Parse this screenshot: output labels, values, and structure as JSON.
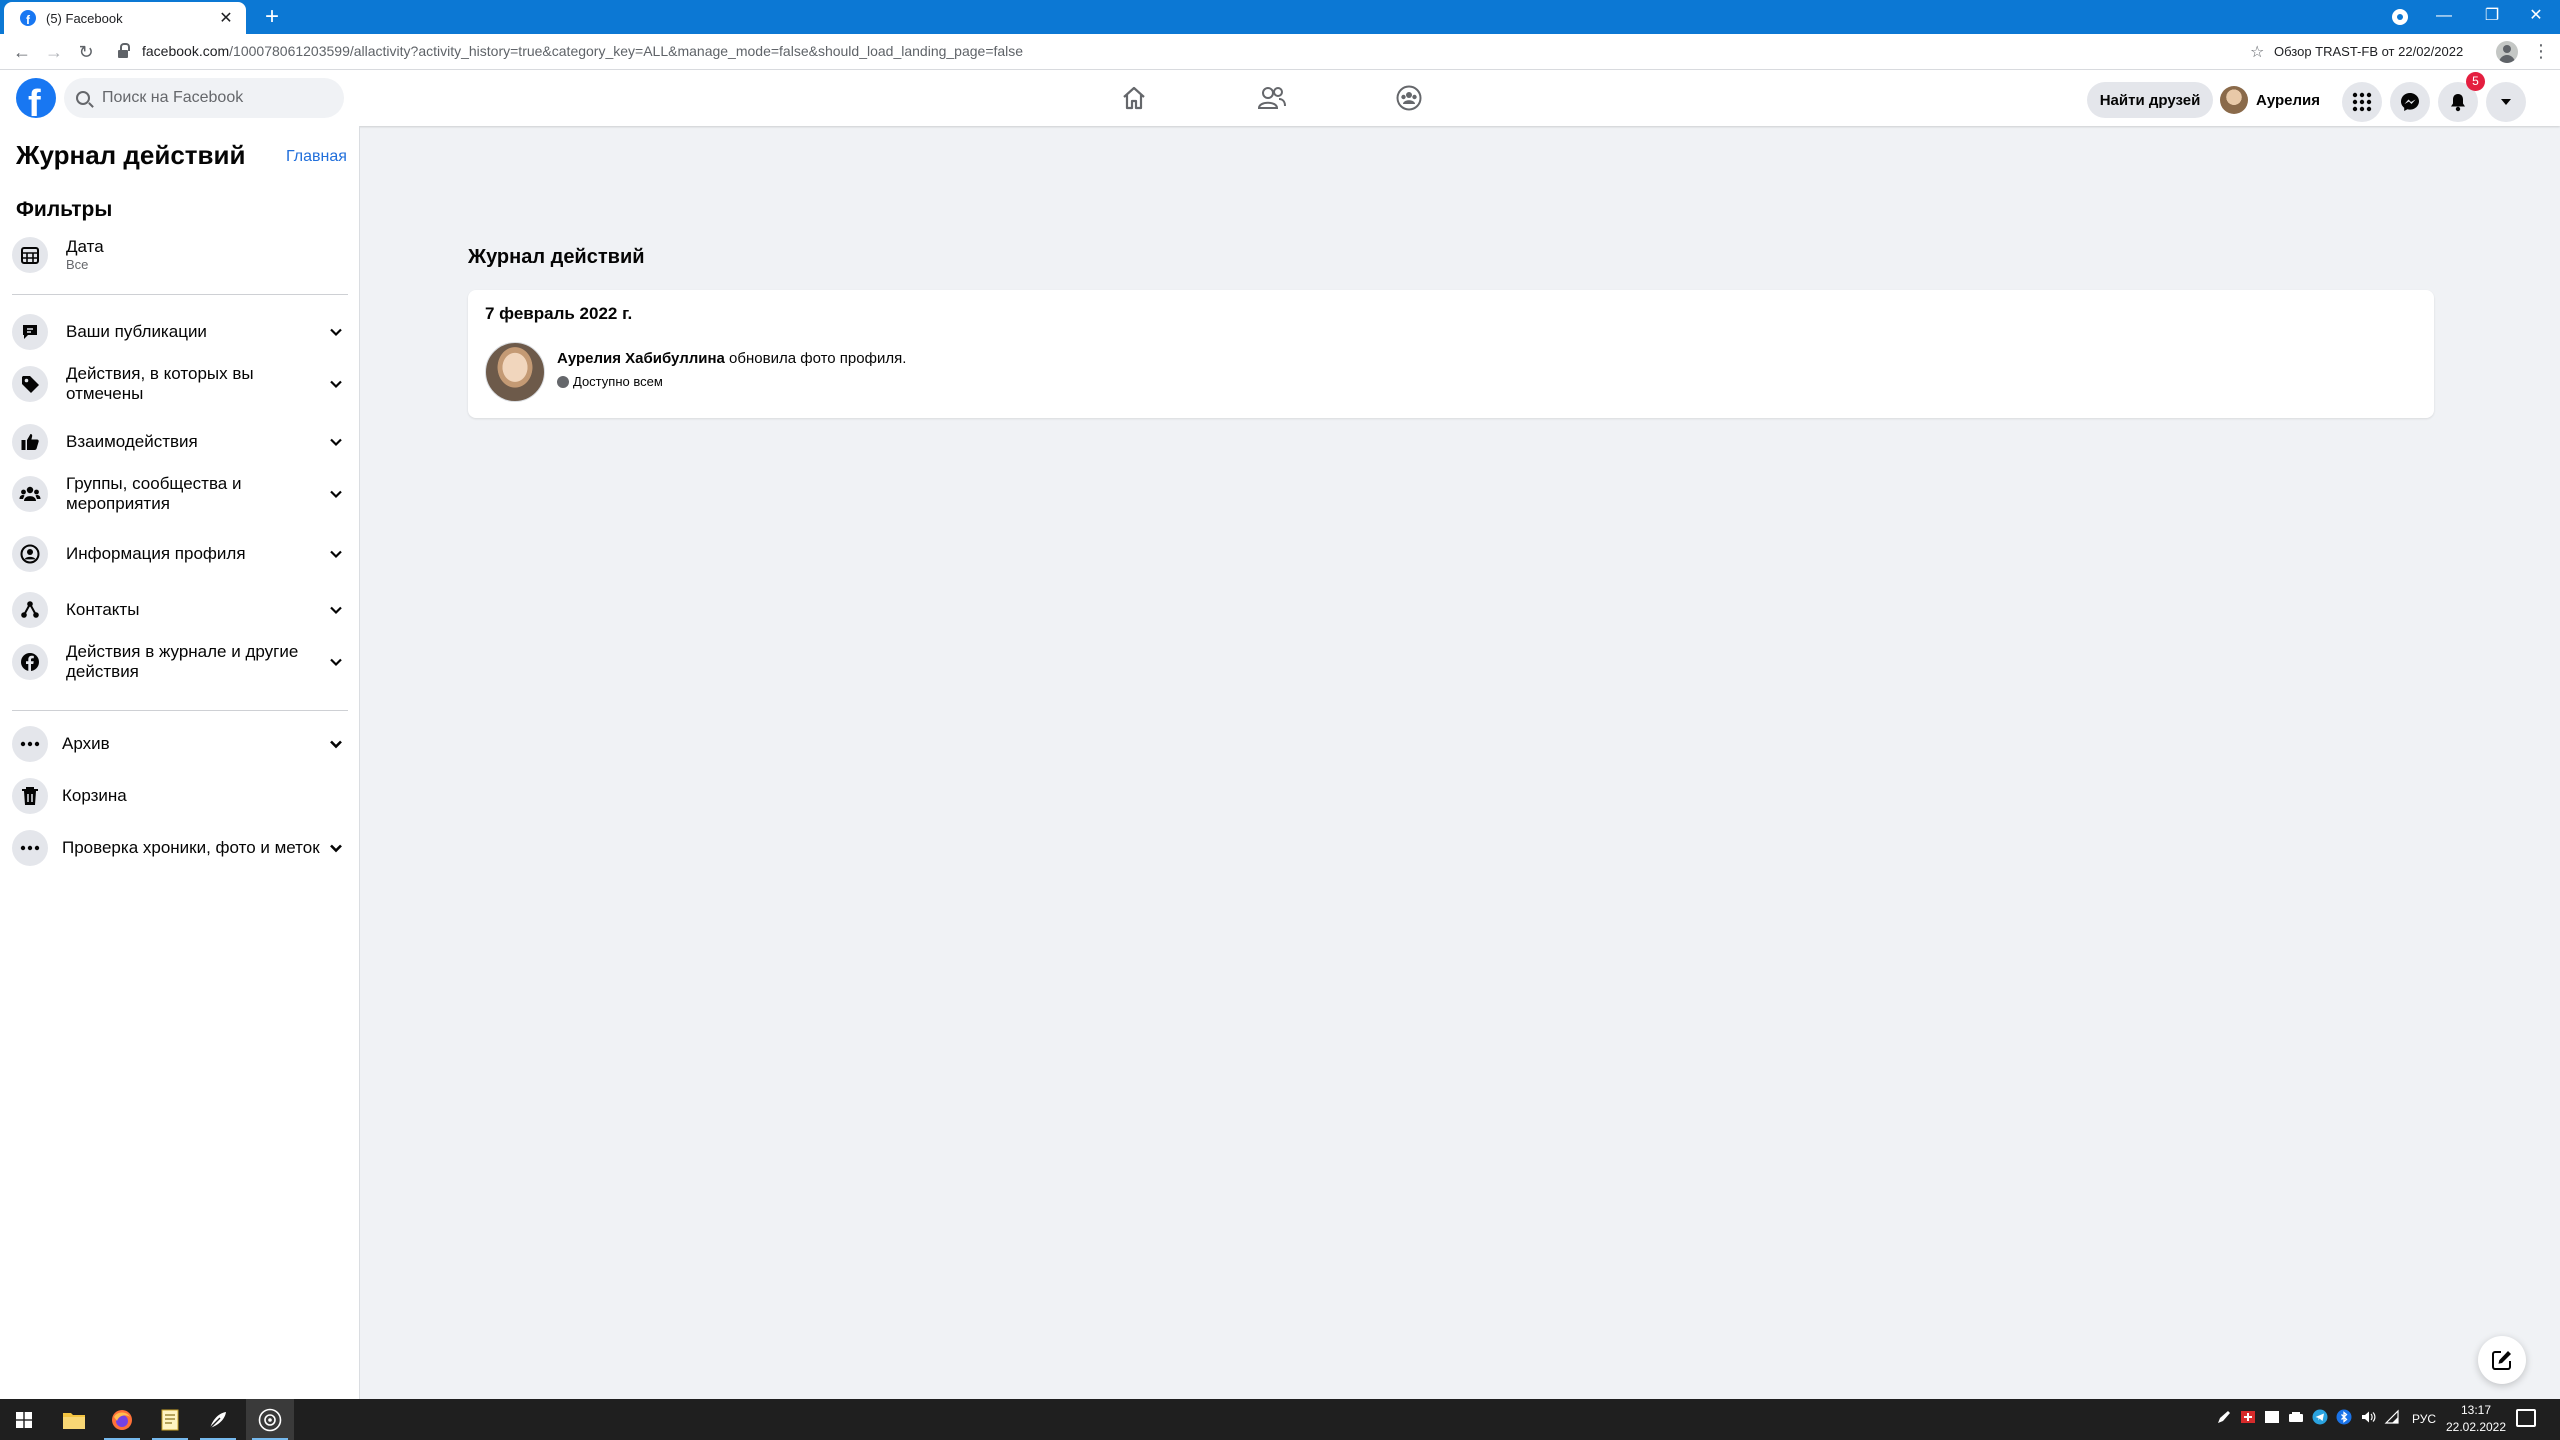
{
  "browser": {
    "tab_title": "(5) Facebook",
    "url_host": "facebook.com",
    "url_path": "/100078061203599/allactivity?activity_history=true&category_key=ALL&manage_mode=false&should_load_landing_page=false",
    "bookmark_label": "Обзор TRAST-FB от 22/02/2022"
  },
  "header": {
    "logo": "f",
    "search_placeholder": "Поиск на Facebook",
    "find_friends": "Найти друзей",
    "user_name": "Аурелия",
    "notifications_count": "5"
  },
  "sidebar": {
    "title": "Журнал действий",
    "home_link": "Главная",
    "filters_heading": "Фильтры",
    "date_filter": {
      "label": "Дата",
      "value": "Все"
    },
    "categories": [
      {
        "label": "Ваши публикации",
        "icon": "comment-icon"
      },
      {
        "label": "Действия, в которых вы отмечены",
        "icon": "tag-icon"
      },
      {
        "label": "Взаимодействия",
        "icon": "thumbs-up-icon"
      },
      {
        "label": "Группы, сообщества и мероприятия",
        "icon": "groups-icon"
      },
      {
        "label": "Информация профиля",
        "icon": "profile-icon"
      },
      {
        "label": "Контакты",
        "icon": "connections-icon"
      },
      {
        "label": "Действия в журнале и другие действия",
        "icon": "facebook-icon"
      }
    ],
    "extra": [
      {
        "label": "Архив",
        "icon": "more-icon"
      },
      {
        "label": "Корзина",
        "icon": "trash-icon"
      },
      {
        "label": "Проверка хроники, фото и меток",
        "icon": "more-icon"
      }
    ]
  },
  "main": {
    "title": "Журнал действий",
    "date_heading": "7 февраль 2022 г.",
    "activity": {
      "actor": "Аурелия Хабибуллина",
      "action": " обновила фото профиля.",
      "privacy": "Доступно всем"
    }
  },
  "taskbar": {
    "language": "РУС",
    "time": "13:17",
    "date": "22.02.2022"
  },
  "colors": {
    "facebook_blue": "#1877f2",
    "chrome_blue": "#0c78d4",
    "badge_red": "#e41e3f",
    "link_blue": "#216fdb"
  }
}
